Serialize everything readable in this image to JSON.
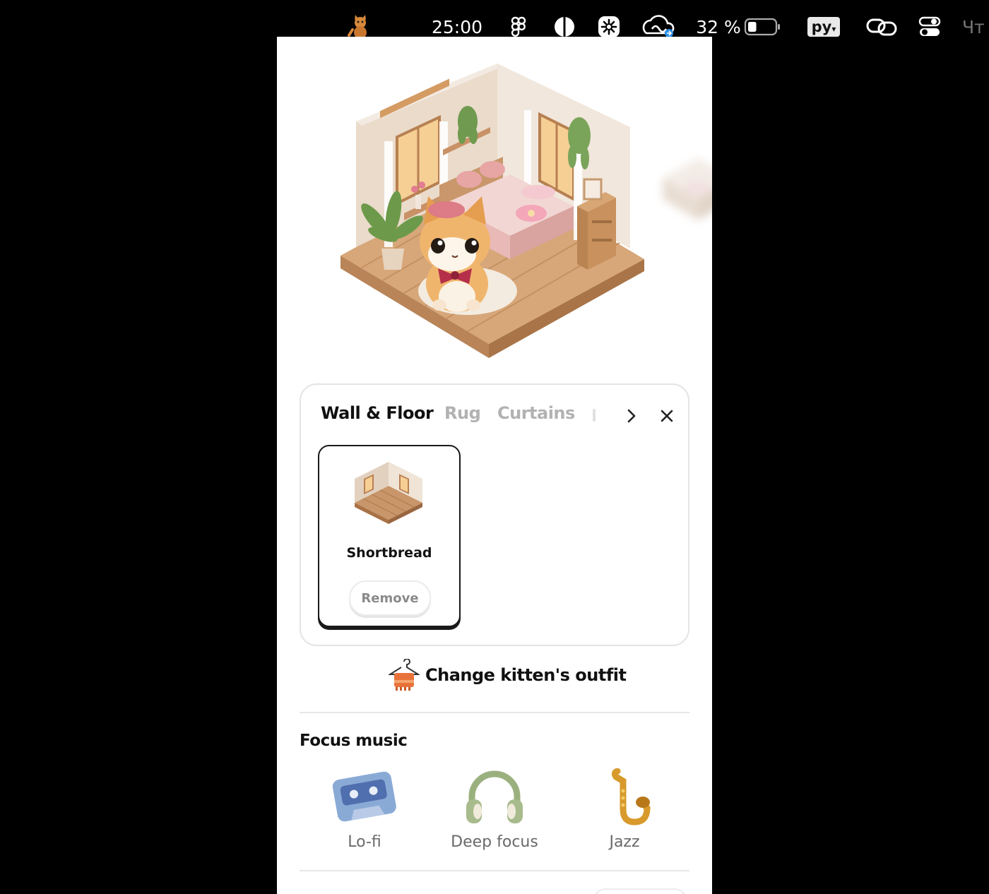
{
  "menubar": {
    "timer": "25:00",
    "battery_percent": "32 %",
    "battery_level": 0.32,
    "language": "ру",
    "day_partial": "Чт",
    "icons": [
      "cat-app-icon",
      "figma-icon",
      "contrast-icon",
      "flower-gear-icon",
      "creative-cloud-sync-icon",
      "battery-icon",
      "keyboard-language-icon",
      "link-icon",
      "control-center-icon"
    ]
  },
  "tabs": [
    {
      "label": "Wall & Floor",
      "active": true
    },
    {
      "label": "Rug",
      "active": false
    },
    {
      "label": "Curtains",
      "active": false
    }
  ],
  "selected_item": {
    "name": "Shortbread",
    "remove_label": "Remove"
  },
  "outfit": {
    "label": "Change kitten's outfit",
    "icon": "hanger-sweater-icon"
  },
  "focus_music": {
    "title": "Focus music",
    "options": [
      {
        "label": "Lo-fi",
        "icon": "cassette-icon"
      },
      {
        "label": "Deep focus",
        "icon": "headphones-icon"
      },
      {
        "label": "Jazz",
        "icon": "saxophone-icon"
      }
    ]
  },
  "colors": {
    "accent_dark": "#111111",
    "inactive_tab": "#b2b2b2",
    "card_border": "#e4e4e4"
  }
}
